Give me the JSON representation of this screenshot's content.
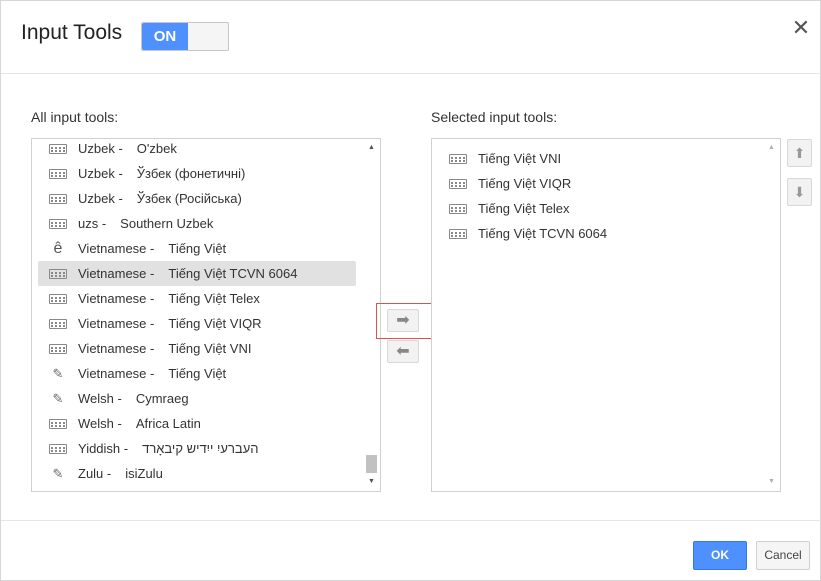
{
  "dialog": {
    "title": "Input Tools",
    "toggle_label": "ON",
    "close_glyph": "✕"
  },
  "all_tools": {
    "label": "All input tools:",
    "items": [
      {
        "lang": "Uzbek -",
        "name": "O'zbek",
        "icon": "keyboard-icon"
      },
      {
        "lang": "Uzbek -",
        "name": "Ўзбек (фонетичні)",
        "icon": "keyboard-icon"
      },
      {
        "lang": "Uzbek -",
        "name": "Ўзбек (Російська)",
        "icon": "keyboard-icon"
      },
      {
        "lang": "uzs -",
        "name": "Southern Uzbek",
        "icon": "keyboard-icon"
      },
      {
        "lang": "Vietnamese -",
        "name": "Tiếng Việt",
        "icon": "transliteration-icon"
      },
      {
        "lang": "Vietnamese -",
        "name": "Tiếng Việt TCVN 6064",
        "icon": "keyboard-icon",
        "selected": true
      },
      {
        "lang": "Vietnamese -",
        "name": "Tiếng Việt Telex",
        "icon": "keyboard-icon"
      },
      {
        "lang": "Vietnamese -",
        "name": "Tiếng Việt VIQR",
        "icon": "keyboard-icon"
      },
      {
        "lang": "Vietnamese -",
        "name": "Tiếng Việt VNI",
        "icon": "keyboard-icon"
      },
      {
        "lang": "Vietnamese -",
        "name": "Tiếng Việt",
        "icon": "pencil-icon"
      },
      {
        "lang": "Welsh -",
        "name": "Cymraeg",
        "icon": "pencil-icon"
      },
      {
        "lang": "Welsh -",
        "name": "Africa Latin",
        "icon": "keyboard-icon"
      },
      {
        "lang": "Yiddish -",
        "name": "העברעיִ ייִדיש קיבאָרד",
        "icon": "keyboard-icon"
      },
      {
        "lang": "Zulu -",
        "name": "isiZulu",
        "icon": "pencil-icon"
      }
    ]
  },
  "selected_tools": {
    "label": "Selected input tools:",
    "items": [
      {
        "name": "Tiếng Việt VNI",
        "icon": "keyboard-icon"
      },
      {
        "name": "Tiếng Việt VIQR",
        "icon": "keyboard-icon"
      },
      {
        "name": "Tiếng Việt Telex",
        "icon": "keyboard-icon"
      },
      {
        "name": "Tiếng Việt TCVN 6064",
        "icon": "keyboard-icon"
      }
    ]
  },
  "buttons": {
    "add_glyph": "➡",
    "remove_glyph": "⬅",
    "move_up_glyph": "⬆",
    "move_down_glyph": "⬇",
    "ok": "OK",
    "cancel": "Cancel"
  },
  "colors": {
    "accent": "#4d90fe",
    "highlight_border": "#d9534f"
  }
}
